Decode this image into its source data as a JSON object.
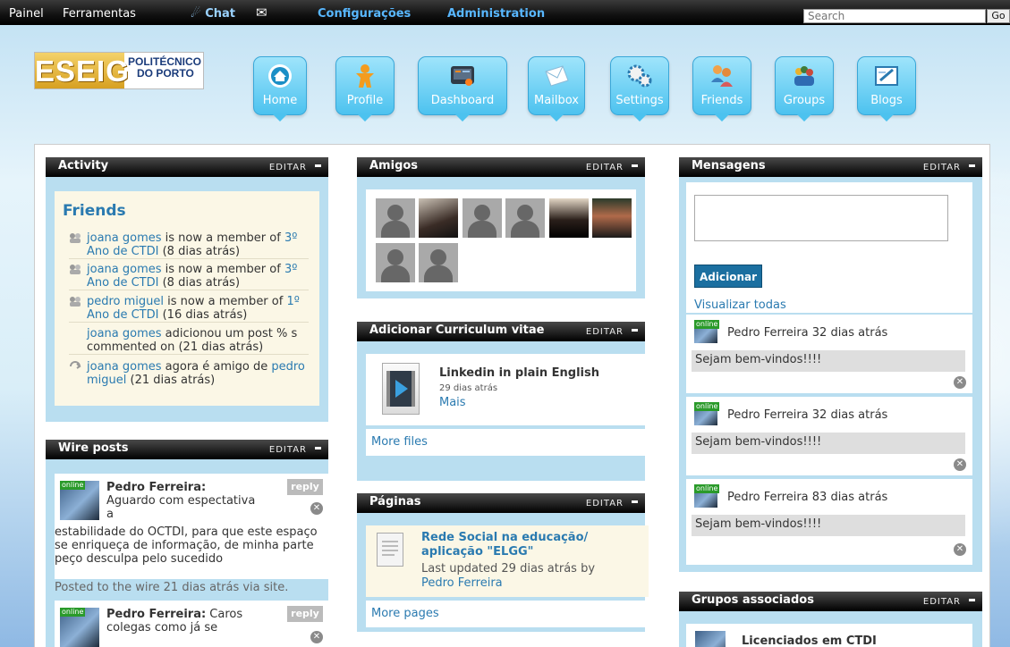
{
  "topbar": {
    "painel": "Painel",
    "ferramentas": "Ferramentas",
    "chat": "Chat",
    "configuracoes": "Configurações",
    "administration": "Administration",
    "search_placeholder": "Search",
    "go": "Go"
  },
  "logo": {
    "main": "ESEIG",
    "sub1": "POLITÉCNICO",
    "sub2": "DO PORTO"
  },
  "nav": [
    {
      "label": "Home",
      "icon": "home-icon"
    },
    {
      "label": "Profile",
      "icon": "profile-icon"
    },
    {
      "label": "Dashboard",
      "icon": "dashboard-icon"
    },
    {
      "label": "Mailbox",
      "icon": "mailbox-icon"
    },
    {
      "label": "Settings",
      "icon": "settings-icon"
    },
    {
      "label": "Friends",
      "icon": "friends-icon"
    },
    {
      "label": "Groups",
      "icon": "groups-icon"
    },
    {
      "label": "Blogs",
      "icon": "blogs-icon"
    }
  ],
  "edit_label": "EDITAR",
  "activity": {
    "title": "Activity",
    "subtitle": "Friends",
    "items": [
      {
        "user": "joana gomes",
        "text": " is now a member of ",
        "link": "3º Ano de CTDI",
        "time": " (8 dias atrás)"
      },
      {
        "user": "joana gomes",
        "text": " is now a member of ",
        "link": "3º Ano de CTDI",
        "time": " (8 dias atrás)"
      },
      {
        "user": "pedro miguel",
        "text": " is now a member of ",
        "link": "1º Ano de CTDI",
        "time": " (16 dias atrás)"
      },
      {
        "user": "joana gomes",
        "text": " adicionou um post % s commented on",
        "link": "",
        "time": " (21 dias atrás)"
      },
      {
        "user": "joana gomes",
        "text": " agora é amigo de ",
        "link": "pedro miguel",
        "time": " (21 dias atrás)"
      }
    ]
  },
  "wire": {
    "title": "Wire posts",
    "online": "online",
    "reply": "reply",
    "posts": [
      {
        "author": "Pedro Ferreira:",
        "text_short": "Aguardo com espectativa a",
        "text_rest": "estabilidade do OCTDI, para que este espaço se enriqueça de informação, de minha parte peço desculpa pelo sucedido",
        "footer": "Posted to the wire 21 dias atrás via site."
      },
      {
        "author": "Pedro Ferreira:",
        "text_short": " Caros colegas como já se"
      }
    ]
  },
  "amigos": {
    "title": "Amigos"
  },
  "curriculum": {
    "title": "Adicionar Curriculum vitae",
    "file_title": "Linkedin in plain English",
    "file_time": "29 dias atrás",
    "more": "Mais",
    "more_files": "More files"
  },
  "paginas": {
    "title": "Páginas",
    "page_title": "Rede Social na educação/ aplicação \"ELGG\"",
    "updated": "Last updated 29 dias atrás by",
    "author": "Pedro Ferreira",
    "more_pages": "More pages"
  },
  "mensagens": {
    "title": "Mensagens",
    "add_button": "Adicionar",
    "view_all": "Visualizar todas",
    "online": "online",
    "items": [
      {
        "header": "Pedro Ferreira 32 dias atrás",
        "body": "Sejam bem-vindos!!!!"
      },
      {
        "header": "Pedro Ferreira 32 dias atrás",
        "body": "Sejam bem-vindos!!!!"
      },
      {
        "header": "Pedro Ferreira 83 dias atrás",
        "body": "Sejam bem-vindos!!!!"
      }
    ]
  },
  "grupos": {
    "title": "Grupos associados",
    "item": "Licenciados em CTDI"
  }
}
